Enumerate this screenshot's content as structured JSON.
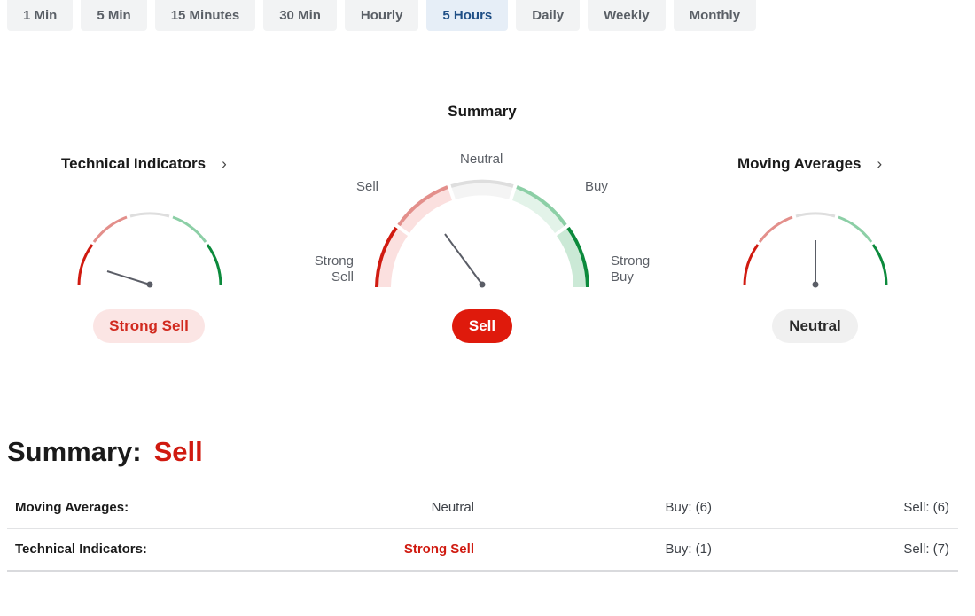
{
  "timeframes": [
    {
      "label": "1 Min",
      "active": false
    },
    {
      "label": "5 Min",
      "active": false
    },
    {
      "label": "15 Minutes",
      "active": false
    },
    {
      "label": "30 Min",
      "active": false
    },
    {
      "label": "Hourly",
      "active": false
    },
    {
      "label": "5 Hours",
      "active": true
    },
    {
      "label": "Daily",
      "active": false
    },
    {
      "label": "Weekly",
      "active": false
    },
    {
      "label": "Monthly",
      "active": false
    }
  ],
  "summary_gauge": {
    "title": "Summary",
    "labels": {
      "neutral": "Neutral",
      "sell": "Sell",
      "buy": "Buy",
      "strong_sell_1": "Strong",
      "strong_sell_2": "Sell",
      "strong_buy_1": "Strong",
      "strong_buy_2": "Buy"
    },
    "result": "Sell"
  },
  "technical_indicators": {
    "title": "Technical Indicators",
    "result": "Strong Sell",
    "icon": "chevron-right-icon"
  },
  "moving_averages": {
    "title": "Moving Averages",
    "result": "Neutral",
    "icon": "chevron-right-icon"
  },
  "colors": {
    "strong_sell": "#d01a10",
    "sell": "#e38f8b",
    "neutral": "#dedede",
    "buy": "#8ccfa6",
    "strong_buy": "#0c8a3c",
    "active_tab": "#1f4f86"
  },
  "bottom": {
    "title": "Summary:",
    "value": "Sell",
    "rows": [
      {
        "label": "Moving Averages:",
        "status": "Neutral",
        "buy": "Buy: (6)",
        "sell": "Sell: (6)"
      },
      {
        "label": "Technical Indicators:",
        "status": "Strong Sell",
        "buy": "Buy: (1)",
        "sell": "Sell: (7)"
      }
    ]
  }
}
